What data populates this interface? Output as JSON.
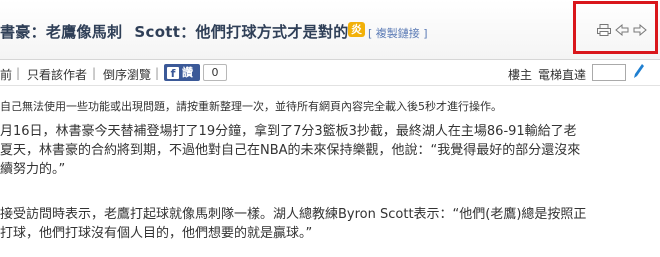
{
  "title": {
    "part1": "書豪：老鷹像馬刺",
    "part2": "Scott：他們打球方式才是對的",
    "badge_glyph": "炎",
    "copy_link": "[ 複製鏈接 ]"
  },
  "tools": {
    "print_icon": "print-icon",
    "prev_icon": "arrow-left-icon",
    "next_icon": "arrow-right-icon",
    "highlight_color": "#d9161b"
  },
  "toolbar": {
    "prev_label": "前",
    "sep1": "|",
    "author_only": "只看該作者",
    "sep2": "|",
    "reverse": "倒序瀏覽",
    "sep3": "|",
    "fb_label": "讚",
    "fb_count": "0",
    "owner": "樓主",
    "jump_label": "電梯直達"
  },
  "notice": "自己無法使用一些功能或出現問題，請按重新整理一次，並待所有網頁內容完全載入後5秒才進行操作。",
  "paragraphs": [
    [
      "月16日，林書豪今天替補登場打了19分鐘，拿到了7分3籃板3抄截，最終湖人在主場86-91輸給了老",
      "夏天，林書豪的合約將到期，不過他對自己在NBA的未來保持樂觀，他說：“我覺得最好的部分還沒來",
      "續努力的。”"
    ],
    [
      "接受訪問時表示，老鷹打起球就像馬刺隊一樣。湖人總教練Byron Scott表示：“他們(老鷹)總是按照正",
      "打球，他們打球沒有個人目的，他們想要的就是贏球。”"
    ]
  ]
}
